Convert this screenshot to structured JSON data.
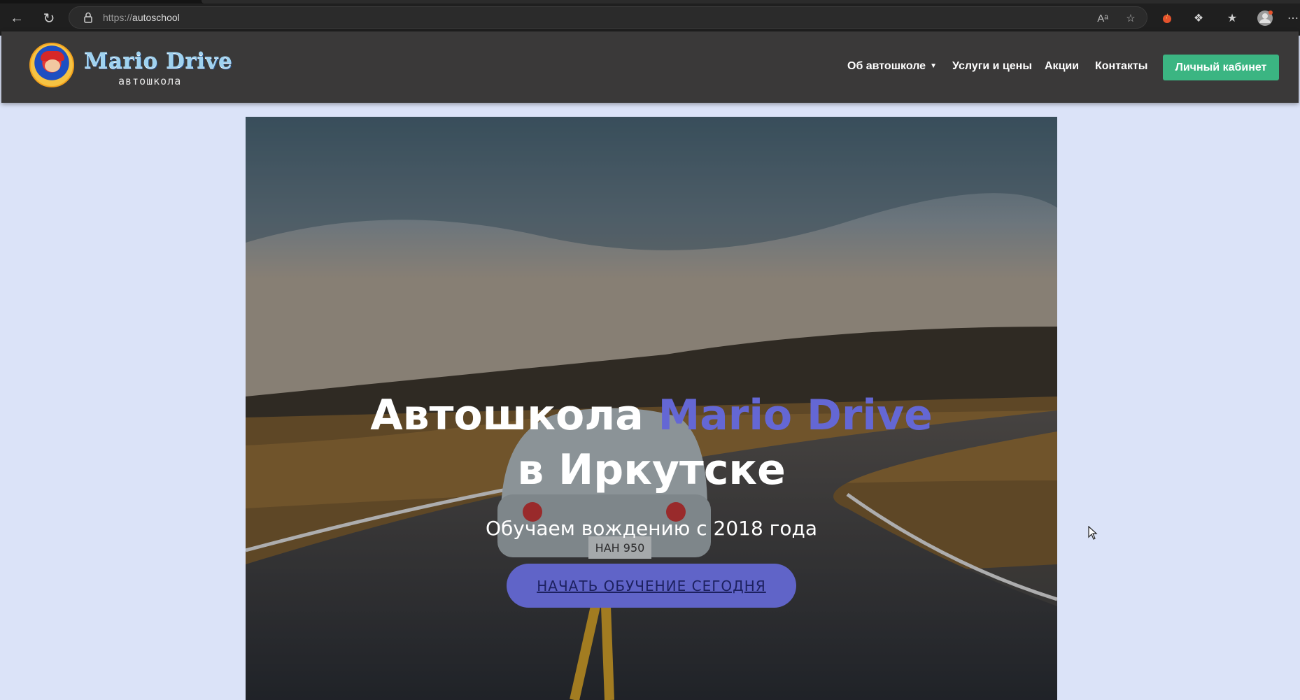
{
  "browser": {
    "url_scheme": "https://",
    "url_host": "autoschool",
    "icons": [
      "back-icon",
      "reload-icon",
      "lock-icon",
      "read-aloud-icon",
      "favorite-star-icon",
      "extension-flame-icon",
      "extensions-icon",
      "favorites-icon",
      "profile-icon",
      "more-icon"
    ]
  },
  "site": {
    "logo_title": "Mario Drive",
    "logo_subtitle": "автошкола",
    "nav": {
      "about": "Об автошколе",
      "services": "Услуги и цены",
      "promos": "Акции",
      "contacts": "Контакты",
      "cabinet": "Личный кабинет"
    }
  },
  "hero": {
    "title_part1": "Автошкола",
    "title_accent": "Mario Drive",
    "title_part2": "в Иркутске",
    "subtitle": "Обучаем вождению с 2018 года",
    "cta": "НАЧАТЬ ОБУЧЕНИЕ СЕГОДНЯ",
    "plate": "HAH 950"
  },
  "colors": {
    "accent": "#6467d4",
    "cta_bg": "#6064c8",
    "cabinet_btn": "#3bb582",
    "header_bg": "#3a3939",
    "page_bg": "#dbe3f8"
  }
}
